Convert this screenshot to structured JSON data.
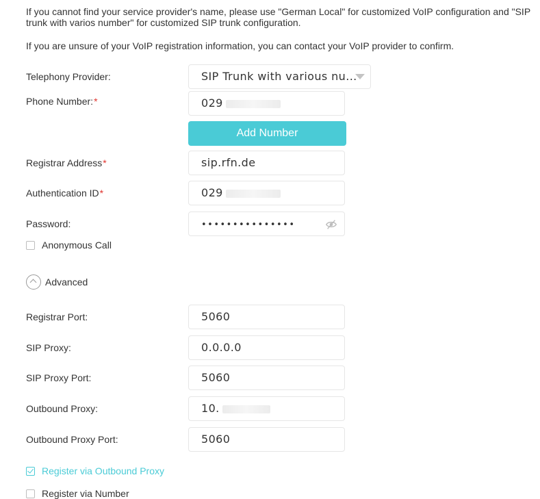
{
  "notes": {
    "line1": "If you cannot find your service provider's name, please use \"German Local\" for customized VoIP configuration and \"SIP trunk with varios number\" for customized SIP trunk configuration.",
    "line2": "If you are unsure of your VoIP registration information, you can contact your VoIP provider to confirm."
  },
  "form": {
    "telephony_provider": {
      "label": "Telephony Provider:",
      "value": "SIP Trunk with various nu..."
    },
    "phone_number": {
      "label": "Phone Number:",
      "required_mark": "*",
      "value": "029"
    },
    "add_number_label": "Add Number",
    "registrar_address": {
      "label": "Registrar Address",
      "required_mark": "*",
      "value": "sip.rfn.de"
    },
    "authentication_id": {
      "label": "Authentication ID",
      "required_mark": "*",
      "value": "029"
    },
    "password": {
      "label": "Password:",
      "value": "•••••••••••••••"
    },
    "anonymous_call": {
      "label": "Anonymous Call",
      "checked": false
    },
    "advanced_label": "Advanced",
    "registrar_port": {
      "label": "Registrar Port:",
      "value": "5060"
    },
    "sip_proxy": {
      "label": "SIP Proxy:",
      "value": "0.0.0.0"
    },
    "sip_proxy_port": {
      "label": "SIP Proxy Port:",
      "value": "5060"
    },
    "outbound_proxy": {
      "label": "Outbound Proxy:",
      "value": "10."
    },
    "outbound_proxy_port": {
      "label": "Outbound Proxy Port:",
      "value": "5060"
    },
    "register_via_outbound_proxy": {
      "label": "Register via Outbound Proxy",
      "checked": true
    },
    "register_via_number": {
      "label": "Register via Number",
      "checked": false
    }
  },
  "colors": {
    "accent": "#4acbd6",
    "required": "#e0342e",
    "text": "#333333",
    "border": "#e6e6e6"
  }
}
